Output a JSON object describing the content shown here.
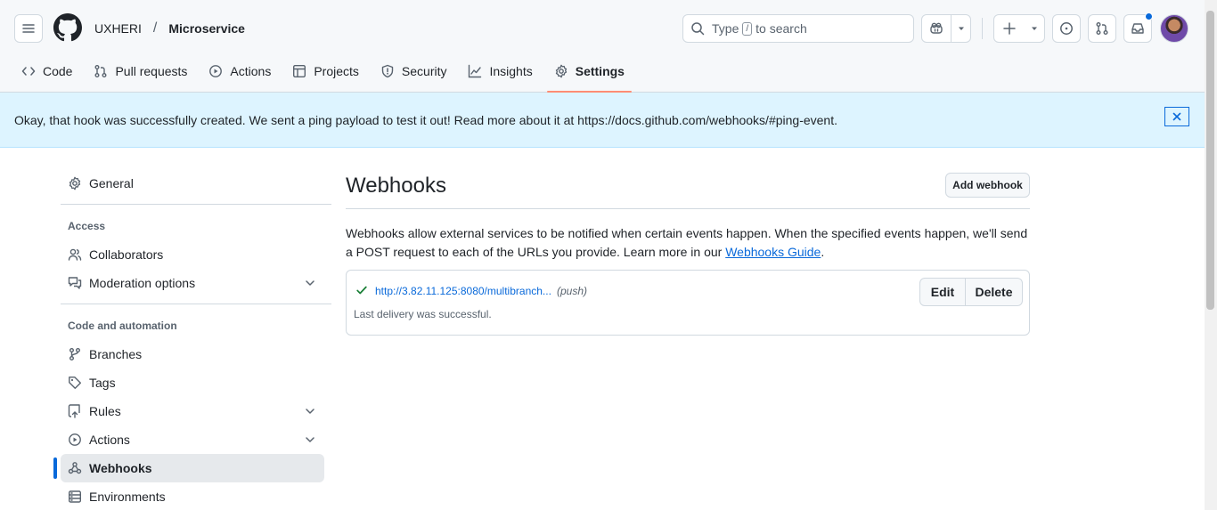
{
  "header": {
    "owner": "UXHERI",
    "separator": "/",
    "repo": "Microservice",
    "search": {
      "prefix": "Type",
      "key": "/",
      "suffix": "to search"
    }
  },
  "tabs": [
    {
      "label": "Code",
      "icon": "code-icon"
    },
    {
      "label": "Pull requests",
      "icon": "git-pull-request-icon"
    },
    {
      "label": "Actions",
      "icon": "play-icon"
    },
    {
      "label": "Projects",
      "icon": "table-icon"
    },
    {
      "label": "Security",
      "icon": "shield-icon"
    },
    {
      "label": "Insights",
      "icon": "graph-icon"
    },
    {
      "label": "Settings",
      "icon": "gear-icon",
      "active": true
    }
  ],
  "flash": {
    "message": "Okay, that hook was successfully created. We sent a ping payload to test it out! Read more about it at https://docs.github.com/webhooks/#ping-event."
  },
  "sidebar": {
    "general": "General",
    "access_heading": "Access",
    "collaborators": "Collaborators",
    "moderation": "Moderation options",
    "code_heading": "Code and automation",
    "branches": "Branches",
    "tags": "Tags",
    "rules": "Rules",
    "actions": "Actions",
    "webhooks": "Webhooks",
    "environments": "Environments"
  },
  "main": {
    "title": "Webhooks",
    "add_button": "Add webhook",
    "description_before": "Webhooks allow external services to be notified when certain events happen. When the specified events happen, we'll send a POST request to each of the URLs you provide. Learn more in our ",
    "description_link": "Webhooks Guide",
    "description_after": ".",
    "hook": {
      "url": "http://3.82.11.125:8080/multibranch...",
      "events": "(push)",
      "status": "Last delivery was successful.",
      "edit": "Edit",
      "delete": "Delete"
    }
  },
  "colors": {
    "accent": "#0969da",
    "flash_bg": "#ddf4ff",
    "tab_underline": "#fd8c73",
    "success": "#1a7f37"
  }
}
